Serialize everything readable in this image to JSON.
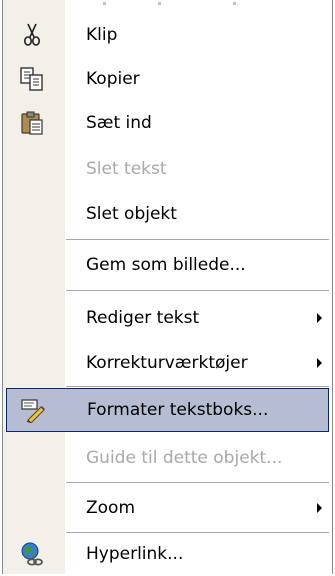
{
  "menu": {
    "items": [
      {
        "id": "klip",
        "label": "Klip",
        "enabled": true,
        "icon": "scissors-icon"
      },
      {
        "id": "kopier",
        "label": "Kopier",
        "enabled": true,
        "icon": "copy-icon"
      },
      {
        "id": "saet-ind",
        "label": "Sæt ind",
        "enabled": true,
        "icon": "paste-icon"
      },
      {
        "id": "slet-tekst",
        "label": "Slet tekst",
        "enabled": false
      },
      {
        "id": "slet-objekt",
        "label": "Slet objekt",
        "enabled": true
      },
      {
        "id": "gem-som-billede",
        "label": "Gem som billede...",
        "enabled": true
      },
      {
        "id": "rediger-tekst",
        "label": "Rediger tekst",
        "enabled": true,
        "submenu": true
      },
      {
        "id": "korrekturvaerktojer",
        "label": "Korrekturværktøjer",
        "enabled": true,
        "submenu": true
      },
      {
        "id": "formater-tekstboks",
        "label": "Formater tekstboks...",
        "enabled": true,
        "icon": "format-textbox-icon",
        "highlighted": true
      },
      {
        "id": "guide",
        "label": "Guide til dette objekt...",
        "enabled": false
      },
      {
        "id": "zoom",
        "label": "Zoom",
        "enabled": true,
        "submenu": true
      },
      {
        "id": "hyperlink",
        "label": "Hyperlink...",
        "enabled": true,
        "icon": "hyperlink-globe-icon"
      }
    ],
    "colors": {
      "highlight_fill": "#b6bdd2",
      "highlight_border": "#0a246a",
      "gutter": "#f2f0e8",
      "disabled_text": "#a8a8a8"
    }
  }
}
